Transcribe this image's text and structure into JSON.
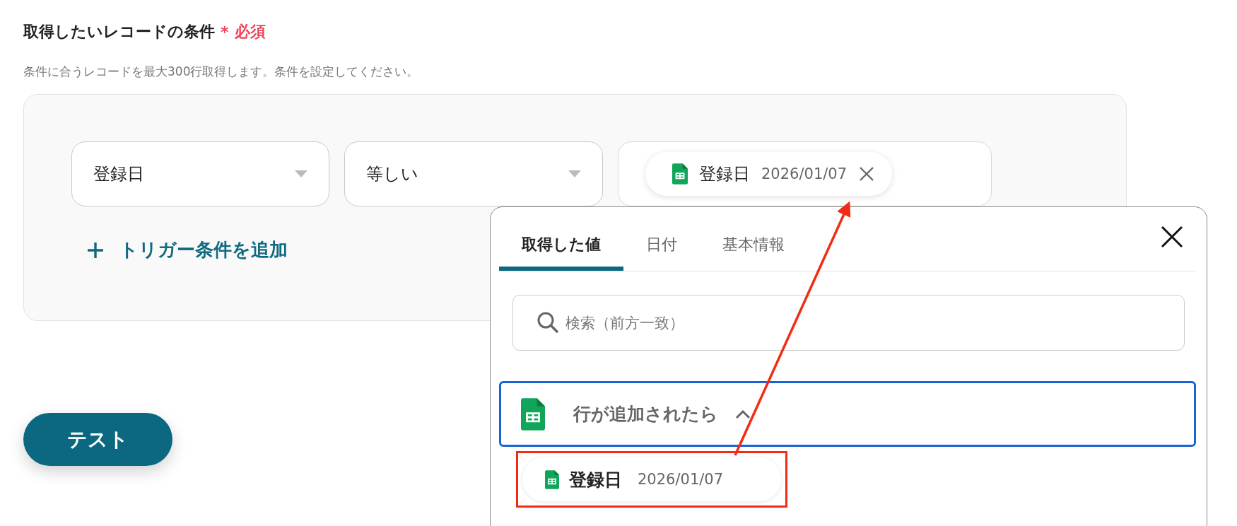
{
  "field": {
    "label": "取得したいレコードの条件",
    "required_mark": "*",
    "required_label": "必須",
    "description": "条件に合うレコードを最大300行取得します。条件を設定してください。"
  },
  "condition": {
    "field_select": {
      "value": "登録日"
    },
    "operator_select": {
      "value": "等しい"
    },
    "value_chip": {
      "label": "登録日",
      "value": "2026/01/07"
    }
  },
  "add_condition": {
    "label": "トリガー条件を追加"
  },
  "test_button": {
    "label": "テスト"
  },
  "picker": {
    "tabs": [
      {
        "label": "取得した値",
        "selected": true
      },
      {
        "label": "日付",
        "selected": false
      },
      {
        "label": "基本情報",
        "selected": false
      }
    ],
    "search": {
      "placeholder": "検索（前方一致）"
    },
    "groups": [
      {
        "title": "行が追加されたら",
        "expanded": true,
        "items": [
          {
            "label": "登録日",
            "value": "2026/01/07",
            "highlighted": true
          }
        ]
      }
    ]
  }
}
